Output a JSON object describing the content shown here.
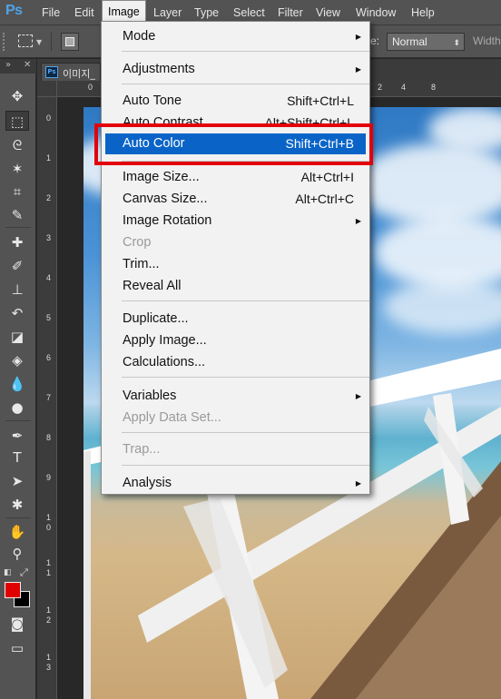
{
  "app": {
    "logo": "Ps"
  },
  "menubar": {
    "items": [
      "File",
      "Edit",
      "Image",
      "Layer",
      "Type",
      "Select",
      "Filter",
      "View",
      "Window",
      "Help"
    ],
    "active": "Image"
  },
  "options": {
    "style_label": "e:",
    "style_value": "Normal",
    "width_label": "Width"
  },
  "document": {
    "title": "이미지_",
    "ruler_h": [
      "0",
      "2",
      "4",
      "6",
      "8"
    ],
    "ruler_v": [
      "0",
      "1",
      "2",
      "3",
      "4",
      "5",
      "6",
      "7",
      "8",
      "9",
      "1\n0",
      "1\n1",
      "1\n2",
      "1\n3"
    ]
  },
  "image_menu": {
    "mode": "Mode",
    "adjustments": "Adjustments",
    "auto_tone": {
      "label": "Auto Tone",
      "shortcut": "Shift+Ctrl+L"
    },
    "auto_contrast": {
      "label": "Auto Contrast",
      "shortcut": "Alt+Shift+Ctrl+L"
    },
    "auto_color": {
      "label": "Auto Color",
      "shortcut": "Shift+Ctrl+B"
    },
    "image_size": {
      "label": "Image Size...",
      "shortcut": "Alt+Ctrl+I"
    },
    "canvas_size": {
      "label": "Canvas Size...",
      "shortcut": "Alt+Ctrl+C"
    },
    "image_rotation": "Image Rotation",
    "crop": "Crop",
    "trim": "Trim...",
    "reveal_all": "Reveal All",
    "duplicate": "Duplicate...",
    "apply_image": "Apply Image...",
    "calculations": "Calculations...",
    "variables": "Variables",
    "apply_data_set": "Apply Data Set...",
    "trap": "Trap...",
    "analysis": "Analysis"
  },
  "colors": {
    "highlight": "#0a64c8",
    "annotation": "#e3000b",
    "foreground": "#e00000",
    "background": "#000000"
  },
  "tools": [
    "move-icon",
    "marquee-icon",
    "lasso-icon",
    "magic-wand-icon",
    "crop-icon",
    "eyedropper-icon",
    "healing-icon",
    "brush-icon",
    "stamp-icon",
    "history-brush-icon",
    "eraser-icon",
    "bucket-icon",
    "blur-icon",
    "dodge-icon",
    "pen-icon",
    "type-icon",
    "path-select-icon",
    "shape-icon",
    "hand-icon",
    "zoom-icon"
  ]
}
